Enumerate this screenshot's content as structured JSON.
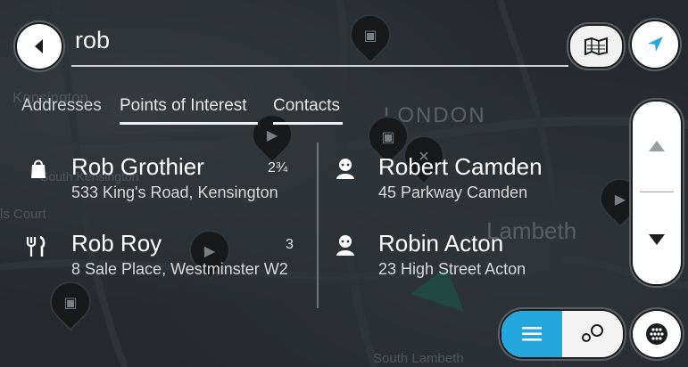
{
  "search": {
    "value": "rob"
  },
  "tabs": [
    {
      "label": "Addresses",
      "active": false
    },
    {
      "label": "Points of Interest",
      "active": true
    },
    {
      "label": "Contacts",
      "active": true
    }
  ],
  "results_left": [
    {
      "name": "Rob Grothier",
      "address": "533 King's Road, Kensington",
      "distance": "2¾",
      "icon": "shopping-bag-icon"
    },
    {
      "name": "Rob Roy",
      "address": "8 Sale Place, Westminster W2",
      "distance": "3",
      "icon": "restaurant-icon"
    }
  ],
  "results_right": [
    {
      "name": "Robert Camden",
      "address": "45 Parkway Camden",
      "icon": "contact-person-icon"
    },
    {
      "name": "Robin Acton",
      "address": "23 High Street Acton",
      "icon": "contact-person-icon"
    }
  ],
  "map_labels": {
    "london": "LONDON",
    "lambeth": "Lambeth",
    "south_kensington": "South Kensington",
    "earls_court": "ls Court",
    "south_lambeth": "South Lambeth"
  },
  "icons": {
    "back": "back-arrow-icon",
    "map_view": "map-icon",
    "navigate": "navigation-arrow-icon",
    "scroll_up": "chevron-up-icon",
    "scroll_down": "chevron-down-icon",
    "list_view": "list-icon",
    "map_results_view": "map-pins-icon",
    "keyboard": "keyboard-icon"
  },
  "colors": {
    "accent": "#23a7dd",
    "background": "#2c3136",
    "text": "#ffffff"
  }
}
